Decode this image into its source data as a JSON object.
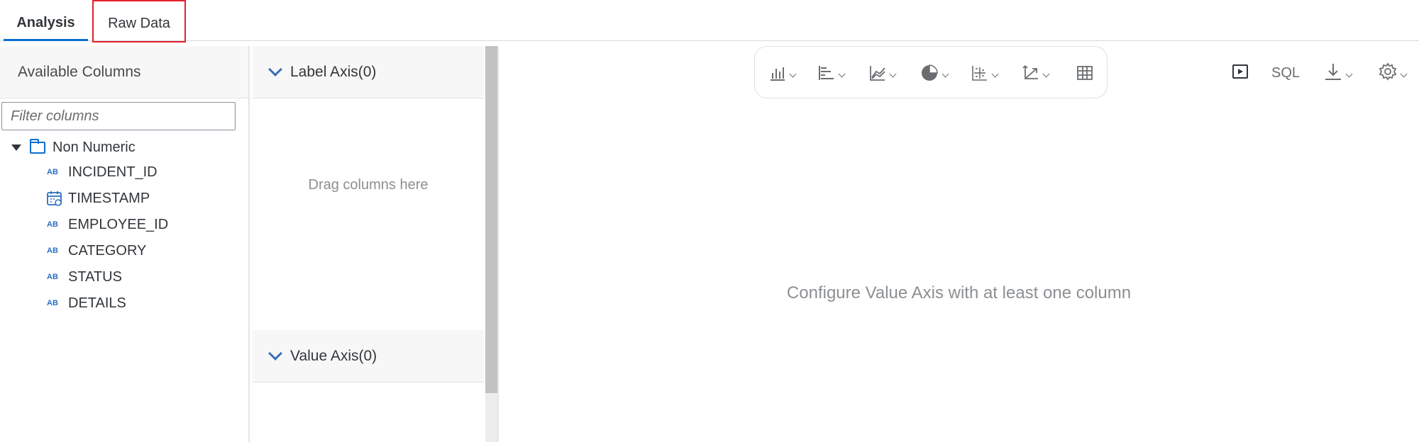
{
  "tabs": [
    {
      "label": "Analysis",
      "active": true
    },
    {
      "label": "Raw Data",
      "active": false
    }
  ],
  "left_panel": {
    "header": "Available Columns",
    "filter_placeholder": "Filter columns",
    "folder": {
      "label": "Non Numeric",
      "icon": "folder-icon",
      "expanded": true,
      "columns": [
        {
          "label": "INCIDENT_ID",
          "icon": "text-type-icon"
        },
        {
          "label": "TIMESTAMP",
          "icon": "calendar-icon"
        },
        {
          "label": "EMPLOYEE_ID",
          "icon": "text-type-icon"
        },
        {
          "label": "CATEGORY",
          "icon": "text-type-icon"
        },
        {
          "label": "STATUS",
          "icon": "text-type-icon"
        },
        {
          "label": "DETAILS",
          "icon": "text-type-icon"
        }
      ]
    }
  },
  "middle_panel": {
    "label_axis": "Label Axis(0)",
    "drag_hint": "Drag columns here",
    "value_axis": "Value Axis(0)"
  },
  "chart_toolbar": {
    "buttons": [
      "column-chart-icon",
      "bar-chart-icon",
      "line-chart-icon",
      "pie-chart-icon",
      "scatter-chart-icon",
      "axis-chart-icon",
      "table-icon"
    ]
  },
  "right_toolbar": {
    "run_icon": "play-icon",
    "sql_label": "SQL",
    "download_icon": "download-icon",
    "settings_icon": "gear-icon"
  },
  "main": {
    "empty_message": "Configure Value Axis with at least one column"
  },
  "colors": {
    "accent": "#0a6ed1",
    "highlight_border": "#e3202a",
    "muted_text": "#8c8f92"
  }
}
